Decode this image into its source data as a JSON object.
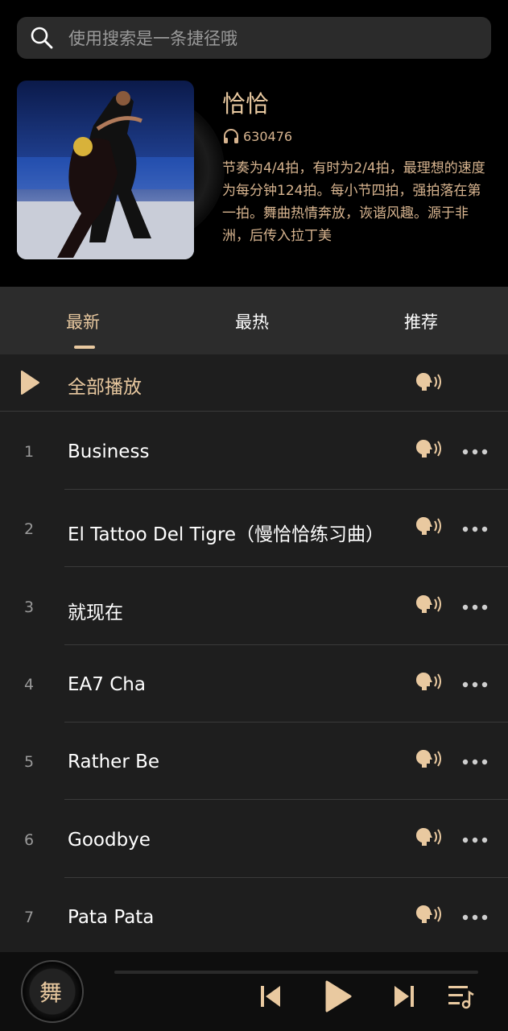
{
  "search": {
    "placeholder": "使用搜索是一条捷径哦"
  },
  "album": {
    "title": "恰恰",
    "play_count": "630476",
    "description": "节奏为4/4拍，有时为2/4拍，最理想的速度为每分钟124拍。每小节四拍，强拍落在第一拍。舞曲热情奔放，诙谐风趣。源于非洲，后传入拉丁美"
  },
  "tabs": [
    {
      "label": "最新",
      "active": true
    },
    {
      "label": "最热",
      "active": false
    },
    {
      "label": "推荐",
      "active": false
    }
  ],
  "play_all": {
    "label": "全部播放"
  },
  "songs": [
    {
      "num": "1",
      "name": "Business"
    },
    {
      "num": "2",
      "name": "El Tattoo Del Tigre（慢恰恰练习曲）"
    },
    {
      "num": "3",
      "name": "就现在"
    },
    {
      "num": "4",
      "name": "EA7 Cha"
    },
    {
      "num": "5",
      "name": "Rather Be"
    },
    {
      "num": "6",
      "name": "Goodbye"
    },
    {
      "num": "7",
      "name": "Pata Pata"
    }
  ],
  "player": {
    "disc_text": "舞",
    "progress": 0
  },
  "colors": {
    "accent": "#e9c9a0",
    "background": "#000000",
    "list_bg": "#1e1e1e"
  }
}
